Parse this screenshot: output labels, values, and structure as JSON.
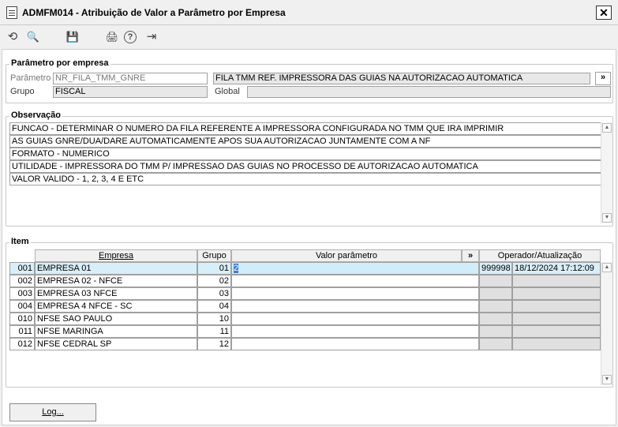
{
  "window": {
    "title": "ADMFM014 - Atribuição de Valor a Parâmetro por Empresa",
    "close": "✕"
  },
  "toolbar": {
    "undo": "⟲",
    "search": "🔍",
    "save": "💾",
    "print": "🖨",
    "help": "?",
    "exit": "⇥"
  },
  "param": {
    "legend": "Parâmetro por empresa",
    "parametro_label": "Parâmetro",
    "parametro_value": "NR_FILA_TMM_GNRE",
    "descricao": "FILA TMM REF. IMPRESSORA DAS GUIAS NA AUTORIZACAO AUTOMATICA",
    "grupo_label": "Grupo",
    "grupo_value": "FISCAL",
    "global_label": "Global",
    "global_value": "",
    "more": "»"
  },
  "obs": {
    "legend": "Observação",
    "lines": [
      "FUNCAO - DETERMINAR O NUMERO DA FILA REFERENTE A IMPRESSORA CONFIGURADA NO TMM QUE IRA IMPRIMIR",
      "AS GUIAS GNRE/DUA/DARE  AUTOMATICAMENTE APOS SUA AUTORIZACAO JUNTAMENTE COM A NF",
      "FORMATO - NUMERICO",
      "UTILIDADE - IMPRESSORA  DO TMM P/ IMPRESSAO DAS GUIAS NO PROCESSO DE AUTORIZACAO AUTOMATICA",
      "VALOR VALIDO - 1, 2, 3, 4 E ETC"
    ]
  },
  "item": {
    "legend": "Item",
    "headers": {
      "empresa": "Empresa",
      "grupo": "Grupo",
      "valor": "Valor parâmetro",
      "more": "»",
      "operador": "Operador/Atualização"
    },
    "rows": [
      {
        "cod": "001",
        "empresa": "EMPRESA 01",
        "grupo": "01",
        "valor": "2",
        "operador": "999998",
        "atualizacao": "18/12/2024 17:12:09"
      },
      {
        "cod": "002",
        "empresa": "EMPRESA 02 - NFCE",
        "grupo": "02",
        "valor": "",
        "operador": "",
        "atualizacao": ""
      },
      {
        "cod": "003",
        "empresa": "EMPRESA 03 NFCE",
        "grupo": "03",
        "valor": "",
        "operador": "",
        "atualizacao": ""
      },
      {
        "cod": "004",
        "empresa": "EMPRESA 4 NFCE - SC",
        "grupo": "04",
        "valor": "",
        "operador": "",
        "atualizacao": ""
      },
      {
        "cod": "010",
        "empresa": "NFSE SAO PAULO",
        "grupo": "10",
        "valor": "",
        "operador": "",
        "atualizacao": ""
      },
      {
        "cod": "011",
        "empresa": "NFSE MARINGA",
        "grupo": "11",
        "valor": "",
        "operador": "",
        "atualizacao": ""
      },
      {
        "cod": "012",
        "empresa": "NFSE CEDRAL SP",
        "grupo": "12",
        "valor": "",
        "operador": "",
        "atualizacao": ""
      }
    ]
  },
  "log_button": "Log...",
  "scroll": {
    "up": "▲",
    "down": "▼"
  }
}
